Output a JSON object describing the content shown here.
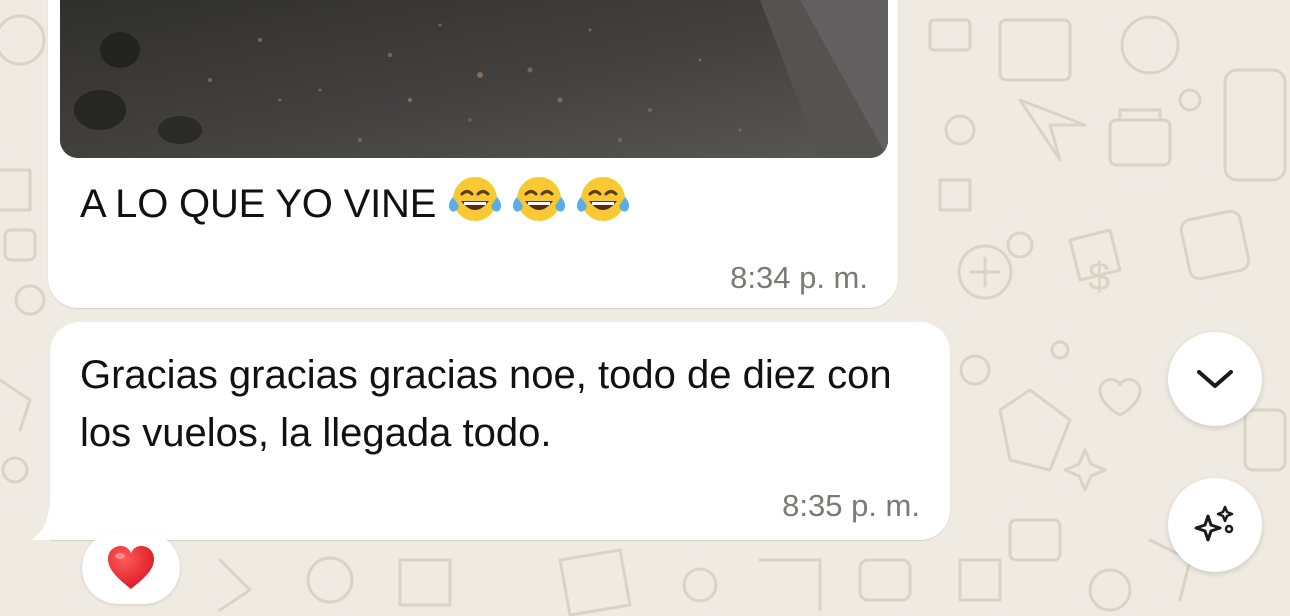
{
  "chat": {
    "background_color": "#efeae2",
    "bubble_color": "#ffffff",
    "messages": [
      {
        "type": "image-with-caption",
        "caption": "A LO QUE YO VINE",
        "caption_emojis": [
          "face-with-tears-of-joy",
          "face-with-tears-of-joy",
          "face-with-tears-of-joy"
        ],
        "time": "8:34",
        "time_suffix": "p. m."
      },
      {
        "type": "text",
        "text": "Gracias gracias gracias noe, todo de diez con los vuelos, la llegada todo.",
        "time": "8:35",
        "time_suffix": "p. m.",
        "reaction": "red-heart"
      }
    ]
  },
  "controls": {
    "scroll_down_icon": "chevron-down-icon",
    "ai_icon": "sparkles-icon"
  }
}
